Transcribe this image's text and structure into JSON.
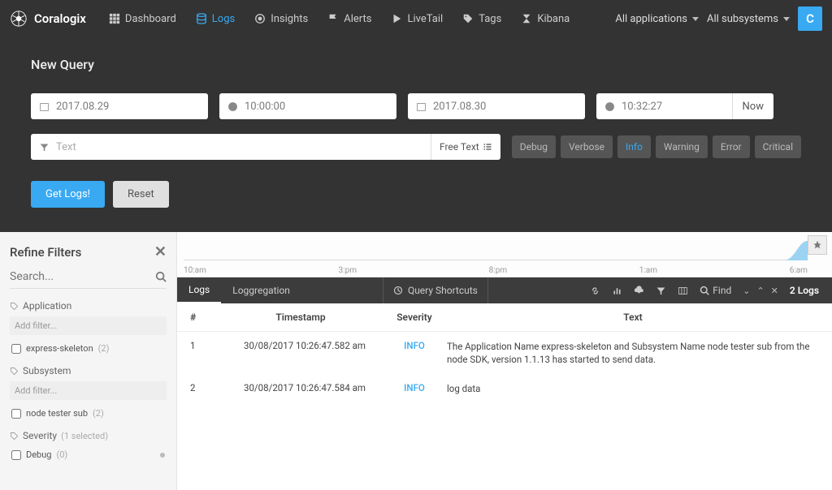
{
  "brand": "Coralogix",
  "nav": {
    "items": [
      {
        "label": "Dashboard",
        "icon": "grid"
      },
      {
        "label": "Logs",
        "icon": "stack",
        "active": true
      },
      {
        "label": "Insights",
        "icon": "target"
      },
      {
        "label": "Alerts",
        "icon": "flag"
      },
      {
        "label": "LiveTail",
        "icon": "play"
      },
      {
        "label": "Tags",
        "icon": "tag"
      },
      {
        "label": "Kibana",
        "icon": "kibana"
      }
    ],
    "apps_label": "All applications",
    "subs_label": "All subsystems",
    "user_initial": "C"
  },
  "query": {
    "title": "New Query",
    "date_start": "2017.08.29",
    "time_start": "10:00:00",
    "date_end": "2017.08.30",
    "time_end": "10:32:27",
    "now_label": "Now",
    "text_placeholder": "Text",
    "freetext_label": "Free Text",
    "severities": [
      "Debug",
      "Verbose",
      "Info",
      "Warning",
      "Error",
      "Critical"
    ],
    "active_severity": "Info",
    "get_logs_label": "Get Logs!",
    "reset_label": "Reset"
  },
  "sidebar": {
    "title": "Refine Filters",
    "search_placeholder": "Search...",
    "add_filter_label": "Add filter...",
    "sections": {
      "application": {
        "label": "Application",
        "items": [
          {
            "name": "express-skeleton",
            "count": "(2)"
          }
        ]
      },
      "subsystem": {
        "label": "Subsystem",
        "items": [
          {
            "name": "node tester sub",
            "count": "(2)"
          }
        ]
      },
      "severity": {
        "label": "Severity",
        "selected_hint": "(1 selected)",
        "items": [
          {
            "name": "Debug",
            "count": "(0)"
          }
        ]
      }
    }
  },
  "timeline": {
    "ticks": [
      "10:am",
      "3:pm",
      "8:pm",
      "1:am",
      "6:am"
    ]
  },
  "tabs": {
    "logs_label": "Logs",
    "loggregation_label": "Loggregation",
    "query_shortcuts_label": "Query Shortcuts",
    "find_label": "Find",
    "count_label": "2 Logs"
  },
  "table": {
    "headers": {
      "idx": "#",
      "timestamp": "Timestamp",
      "severity": "Severity",
      "text": "Text"
    },
    "rows": [
      {
        "idx": "1",
        "ts": "30/08/2017 10:26:47.582 am",
        "sev": "INFO",
        "text": "The Application Name express-skeleton and Subsystem Name node tester sub from the node SDK, version 1.1.13 has started to send data."
      },
      {
        "idx": "2",
        "ts": "30/08/2017 10:26:47.584 am",
        "sev": "INFO",
        "text": "log data"
      }
    ]
  }
}
